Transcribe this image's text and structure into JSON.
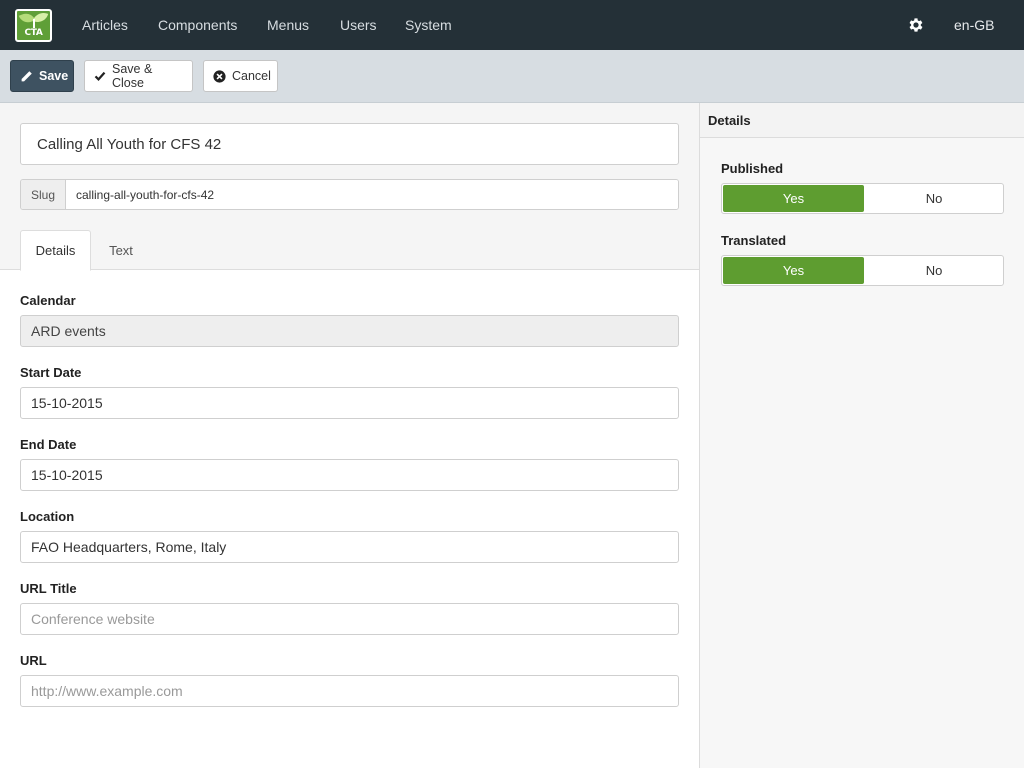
{
  "nav": {
    "logo_text": "CTA",
    "items": [
      {
        "label": "Articles"
      },
      {
        "label": "Components"
      },
      {
        "label": "Menus"
      },
      {
        "label": "Users"
      },
      {
        "label": "System"
      }
    ],
    "settings_icon": "gear-icon",
    "language": "en-GB"
  },
  "toolbar": {
    "save_label": "Save",
    "save_close_label": "Save & Close",
    "cancel_label": "Cancel",
    "icons": {
      "save": "pencil-icon",
      "save_close": "check-icon",
      "cancel": "close-circle-icon"
    },
    "save_color": "#3e5261"
  },
  "form": {
    "title_value": "Calling All Youth for CFS 42",
    "slug_label": "Slug",
    "slug_value": "calling-all-youth-for-cfs-42",
    "tabs": [
      {
        "label": "Details",
        "active": true
      },
      {
        "label": "Text",
        "active": false
      }
    ],
    "fields": {
      "calendar": {
        "label": "Calendar",
        "value": "ARD events"
      },
      "start_date": {
        "label": "Start Date",
        "value": "15-10-2015"
      },
      "end_date": {
        "label": "End Date",
        "value": "15-10-2015"
      },
      "location": {
        "label": "Location",
        "value": "FAO Headquarters, Rome, Italy"
      },
      "url_title": {
        "label": "URL Title",
        "value": "",
        "placeholder": "Conference website"
      },
      "url": {
        "label": "URL",
        "value": "",
        "placeholder": "http://www.example.com"
      }
    }
  },
  "sidebar": {
    "header": "Details",
    "published": {
      "label": "Published",
      "yes": "Yes",
      "no": "No",
      "selected": "Yes"
    },
    "translated": {
      "label": "Translated",
      "yes": "Yes",
      "no": "No",
      "selected": "Yes"
    },
    "accent_color": "#5e9d30"
  }
}
